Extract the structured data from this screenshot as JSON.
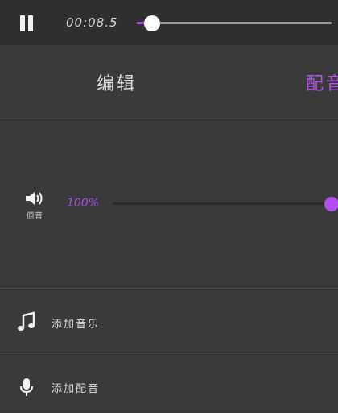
{
  "player": {
    "time": "00:08.5",
    "progress": 0.08,
    "accent_color": "#a64ee0"
  },
  "tabs": [
    {
      "label": "编辑",
      "active": false
    },
    {
      "label": "配音",
      "active": true
    }
  ],
  "volume": {
    "icon": "speaker-icon",
    "label": "原音",
    "value_text": "100%",
    "value": 1.0
  },
  "actions": [
    {
      "icon": "music-note-icon",
      "label": "添加音乐"
    },
    {
      "icon": "microphone-icon",
      "label": "添加配音"
    }
  ]
}
